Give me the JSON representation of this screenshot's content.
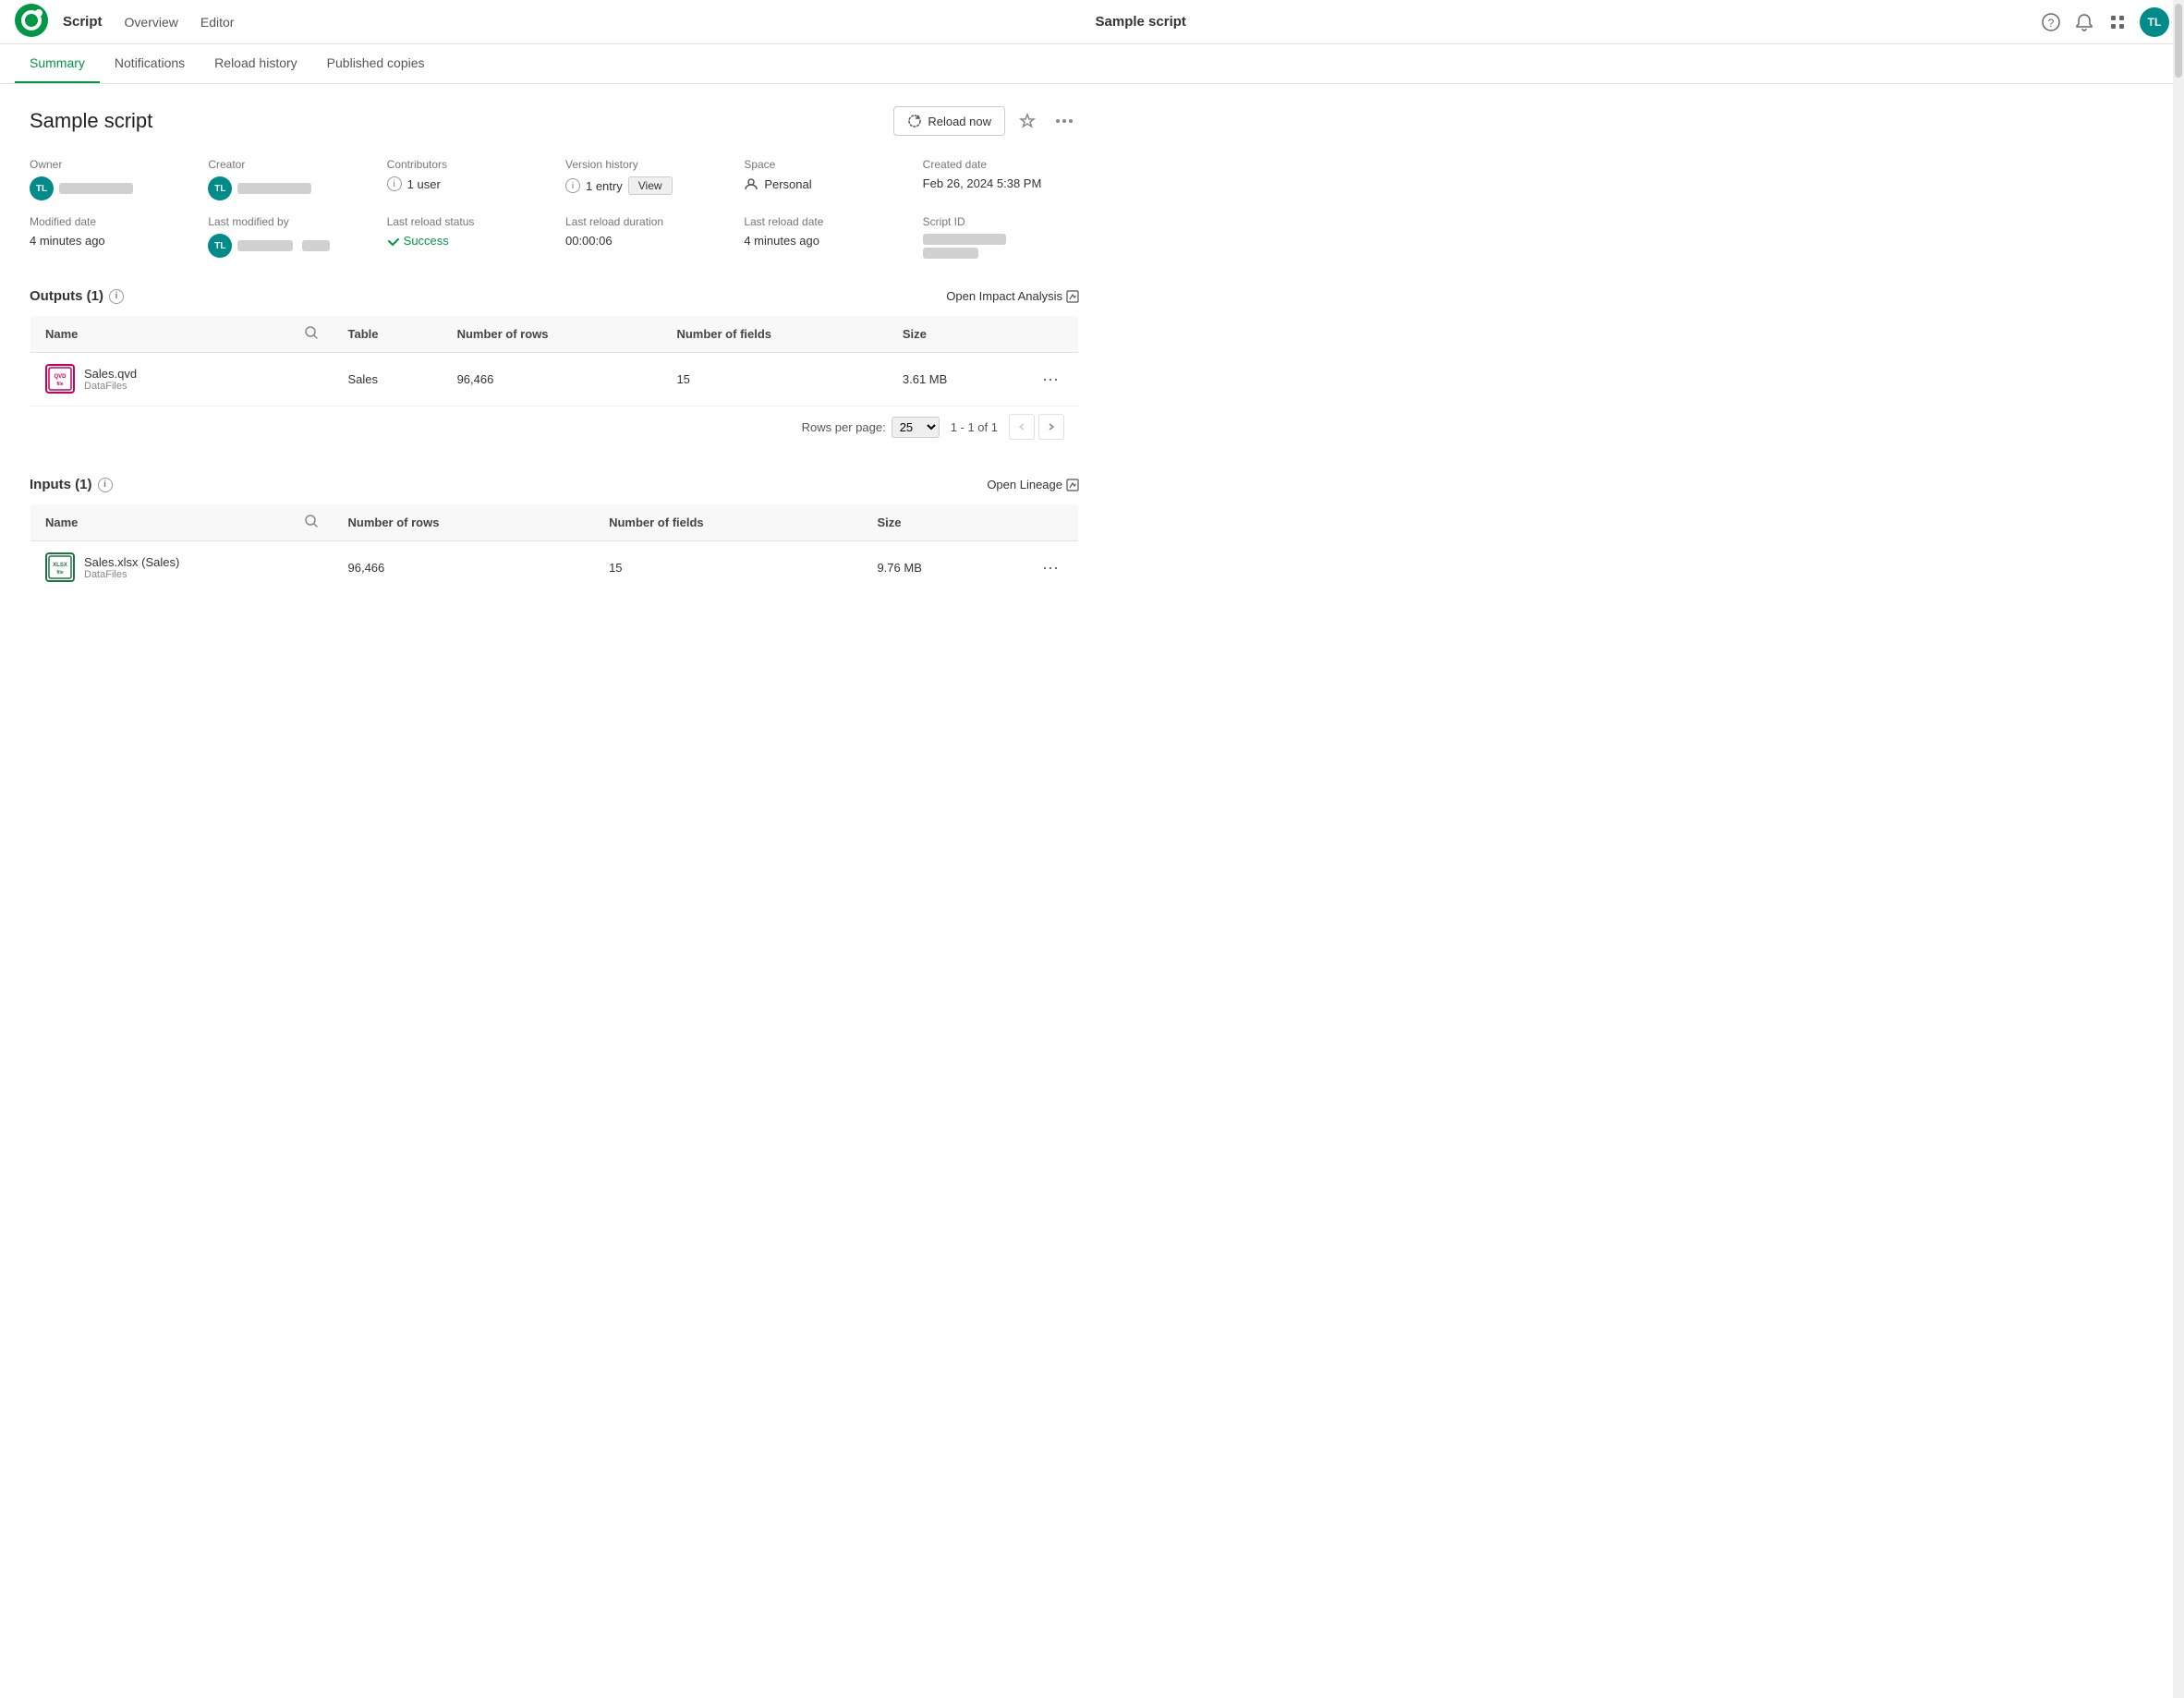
{
  "topNav": {
    "logo_label": "Qlik",
    "app_type": "Script",
    "nav_overview": "Overview",
    "nav_editor": "Editor",
    "app_title": "Sample script",
    "help_icon": "?",
    "bell_icon": "🔔",
    "grid_icon": "⊞",
    "avatar_initials": "TL"
  },
  "tabs": [
    {
      "id": "summary",
      "label": "Summary",
      "active": true
    },
    {
      "id": "notifications",
      "label": "Notifications",
      "active": false
    },
    {
      "id": "reload_history",
      "label": "Reload history",
      "active": false
    },
    {
      "id": "published_copies",
      "label": "Published copies",
      "active": false
    }
  ],
  "pageTitle": "Sample script",
  "reloadButton": "Reload now",
  "metadata": {
    "owner_label": "Owner",
    "owner_initials": "TL",
    "creator_label": "Creator",
    "creator_initials": "TL",
    "contributors_label": "Contributors",
    "contributors_value": "1 user",
    "version_history_label": "Version history",
    "version_history_value": "1 entry",
    "version_view_btn": "View",
    "space_label": "Space",
    "space_icon": "👤",
    "space_value": "Personal",
    "created_label": "Created date",
    "created_value": "Feb 26, 2024 5:38 PM",
    "modified_label": "Modified date",
    "modified_value": "4 minutes ago",
    "last_modified_label": "Last modified by",
    "last_modified_initials": "TL",
    "reload_status_label": "Last reload status",
    "reload_status_value": "Success",
    "reload_duration_label": "Last reload duration",
    "reload_duration_value": "00:00:06",
    "reload_date_label": "Last reload date",
    "reload_date_value": "4 minutes ago",
    "script_id_label": "Script ID"
  },
  "outputs": {
    "section_title": "Outputs (1)",
    "action_label": "Open Impact Analysis",
    "table_columns": {
      "name": "Name",
      "table": "Table",
      "num_rows": "Number of rows",
      "num_fields": "Number of fields",
      "size": "Size"
    },
    "rows": [
      {
        "file_name": "Sales.qvd",
        "file_sub": "DataFiles",
        "file_type": "qvd",
        "table": "Sales",
        "num_rows": "96,466",
        "num_fields": "15",
        "size": "3.61 MB"
      }
    ],
    "pagination": {
      "rows_per_page_label": "Rows per page:",
      "rows_per_page_value": "25",
      "page_info": "1 - 1 of 1"
    }
  },
  "inputs": {
    "section_title": "Inputs (1)",
    "action_label": "Open Lineage",
    "table_columns": {
      "name": "Name",
      "num_rows": "Number of rows",
      "num_fields": "Number of fields",
      "size": "Size"
    },
    "rows": [
      {
        "file_name": "Sales.xlsx (Sales)",
        "file_sub": "DataFiles",
        "file_type": "xlsx",
        "num_rows": "96,466",
        "num_fields": "15",
        "size": "9.76 MB"
      }
    ]
  }
}
